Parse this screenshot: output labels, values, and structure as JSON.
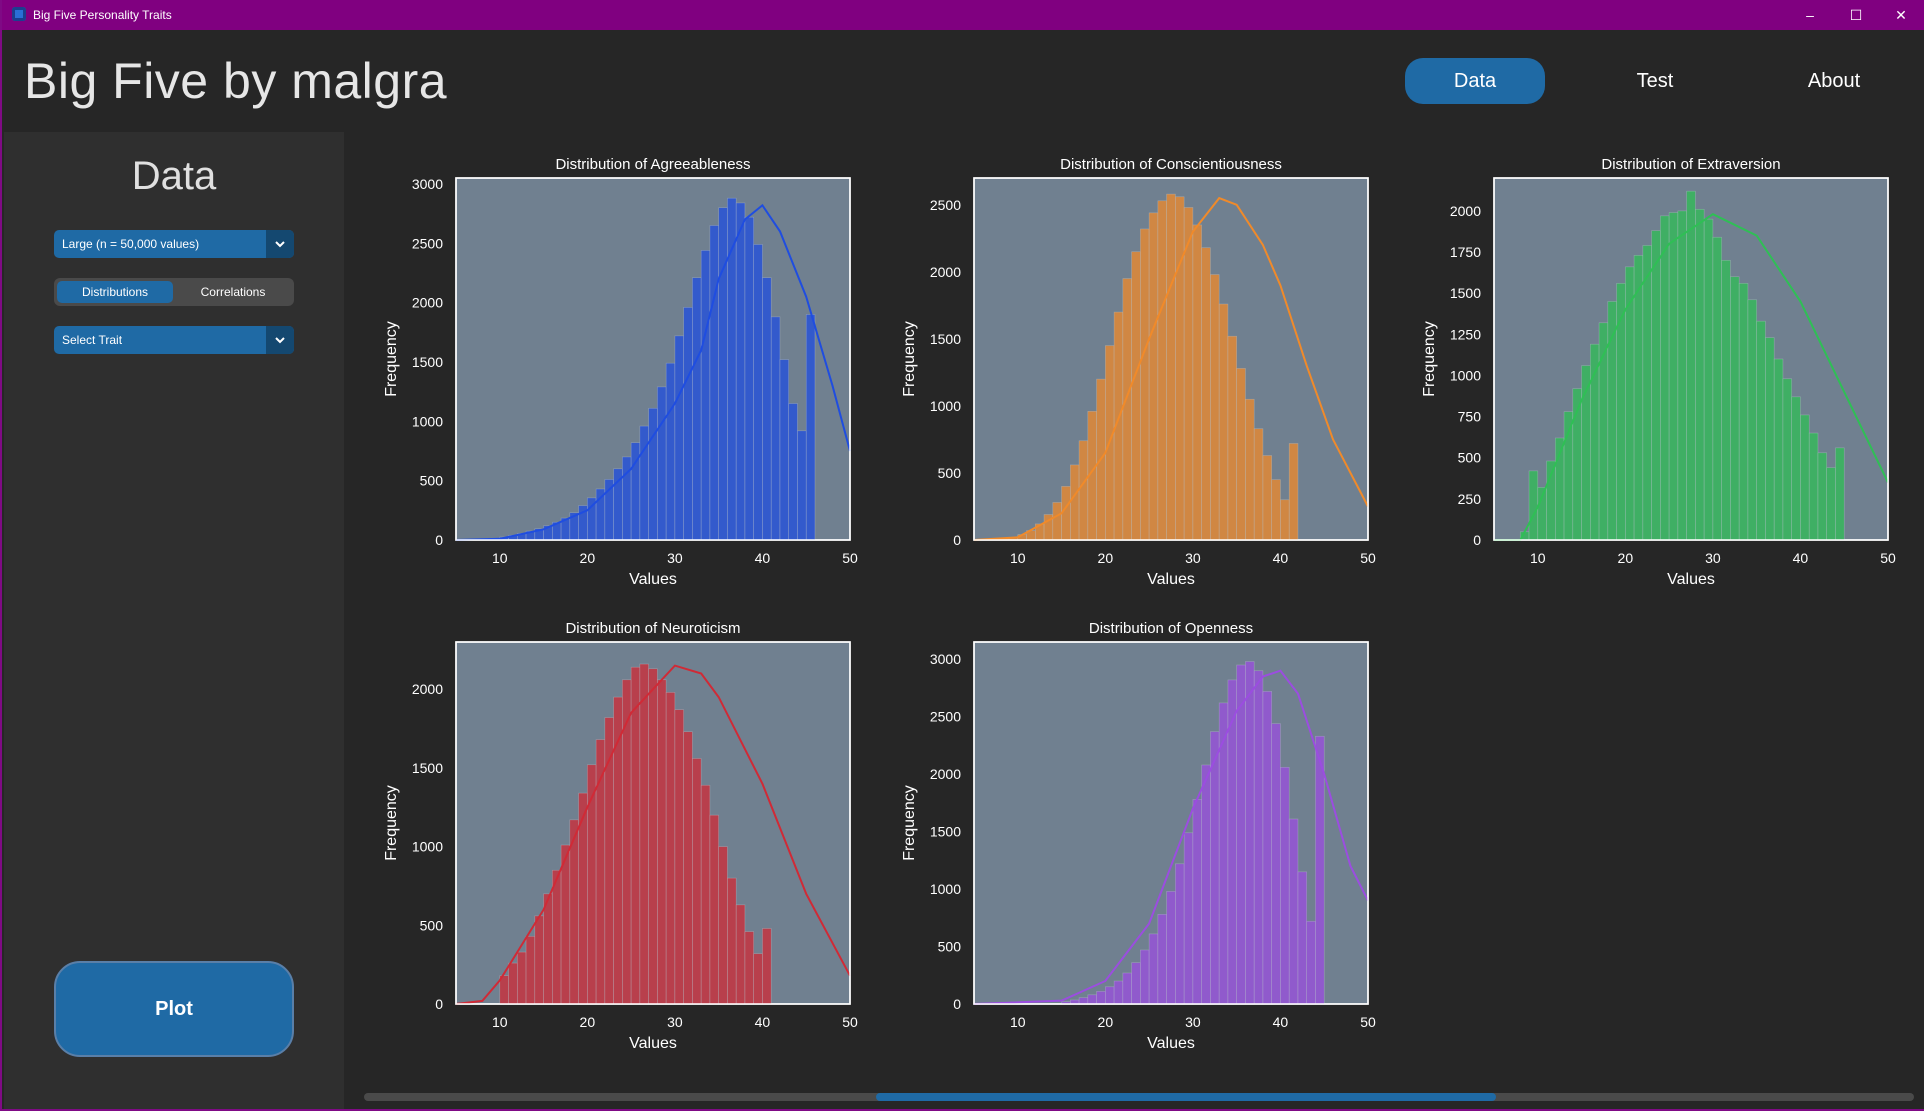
{
  "window": {
    "title": "Big Five Personality Traits",
    "controls": {
      "minimize": "–",
      "maximize": "☐",
      "close": "✕"
    }
  },
  "header": {
    "app_title": "Big Five by malgra",
    "nav": [
      {
        "label": "Data",
        "active": true
      },
      {
        "label": "Test",
        "active": false
      },
      {
        "label": "About",
        "active": false
      }
    ]
  },
  "sidebar": {
    "heading": "Data",
    "dataset_select": {
      "value": "Large (n = 50,000 values)"
    },
    "view_toggle": {
      "options": [
        "Distributions",
        "Correlations"
      ],
      "selected": "Distributions"
    },
    "trait_select": {
      "value": "Select Trait"
    },
    "plot_button": "Plot"
  },
  "colors": {
    "accent": "#1f6aa5",
    "titlebar": "#800080",
    "plot_bg": "#708090"
  },
  "scrollbar": {
    "position": 0.33,
    "visible_fraction": 0.4
  },
  "chart_data": [
    {
      "type": "bar",
      "title": "Distribution of Agreeableness",
      "xlabel": "Values",
      "ylabel": "Frequency",
      "color": "#1f4de0",
      "xlim": [
        5,
        50
      ],
      "ylim": [
        0,
        3050
      ],
      "xticks": [
        10,
        20,
        30,
        40,
        50
      ],
      "yticks": [
        0,
        500,
        1000,
        1500,
        2000,
        2500,
        3000
      ],
      "bin_start": 5,
      "bin_width": 1,
      "values": [
        0,
        0,
        5,
        10,
        15,
        25,
        40,
        55,
        75,
        95,
        120,
        150,
        185,
        230,
        290,
        355,
        430,
        510,
        600,
        700,
        820,
        960,
        1110,
        1290,
        1490,
        1720,
        1960,
        2210,
        2440,
        2650,
        2800,
        2880,
        2840,
        2720,
        2490,
        2210,
        1880,
        1520,
        1150,
        920,
        1900
      ],
      "kde": [
        [
          5,
          0
        ],
        [
          10,
          10
        ],
        [
          15,
          90
        ],
        [
          20,
          250
        ],
        [
          25,
          600
        ],
        [
          30,
          1150
        ],
        [
          33,
          1600
        ],
        [
          35,
          2200
        ],
        [
          38,
          2700
        ],
        [
          40,
          2820
        ],
        [
          42,
          2600
        ],
        [
          45,
          2050
        ],
        [
          48,
          1300
        ],
        [
          50,
          750
        ]
      ]
    },
    {
      "type": "bar",
      "title": "Distribution of Conscientiousness",
      "xlabel": "Values",
      "ylabel": "Frequency",
      "color": "#f08a2a",
      "xlim": [
        5,
        50
      ],
      "ylim": [
        0,
        2700
      ],
      "xticks": [
        10,
        20,
        30,
        40,
        50
      ],
      "yticks": [
        0,
        500,
        1000,
        1500,
        2000,
        2500
      ],
      "bin_start": 5,
      "bin_width": 1,
      "values": [
        0,
        0,
        5,
        10,
        20,
        40,
        70,
        120,
        190,
        280,
        400,
        560,
        740,
        960,
        1200,
        1450,
        1700,
        1950,
        2150,
        2320,
        2440,
        2530,
        2580,
        2560,
        2480,
        2350,
        2180,
        1980,
        1760,
        1520,
        1280,
        1050,
        830,
        630,
        450,
        300,
        720
      ],
      "kde": [
        [
          5,
          0
        ],
        [
          10,
          20
        ],
        [
          15,
          200
        ],
        [
          20,
          650
        ],
        [
          25,
          1500
        ],
        [
          30,
          2300
        ],
        [
          33,
          2550
        ],
        [
          35,
          2500
        ],
        [
          38,
          2200
        ],
        [
          40,
          1900
        ],
        [
          43,
          1300
        ],
        [
          46,
          750
        ],
        [
          50,
          250
        ]
      ]
    },
    {
      "type": "bar",
      "title": "Distribution of Extraversion",
      "xlabel": "Values",
      "ylabel": "Frequency",
      "color": "#2fbf55",
      "xlim": [
        5,
        50
      ],
      "ylim": [
        0,
        2200
      ],
      "xticks": [
        10,
        20,
        30,
        40,
        50
      ],
      "yticks": [
        0,
        250,
        500,
        750,
        1000,
        1250,
        1500,
        1750,
        2000
      ],
      "bin_start": 8,
      "bin_width": 1,
      "values": [
        50,
        420,
        320,
        480,
        620,
        780,
        920,
        1060,
        1190,
        1320,
        1450,
        1560,
        1660,
        1730,
        1790,
        1880,
        1970,
        1990,
        2000,
        2120,
        2010,
        1950,
        1840,
        1700,
        1600,
        1560,
        1460,
        1330,
        1230,
        1100,
        980,
        870,
        760,
        650,
        530,
        440,
        560
      ],
      "kde": [
        [
          5,
          0
        ],
        [
          8,
          0
        ],
        [
          10,
          200
        ],
        [
          15,
          850
        ],
        [
          20,
          1400
        ],
        [
          25,
          1800
        ],
        [
          30,
          1980
        ],
        [
          35,
          1850
        ],
        [
          40,
          1450
        ],
        [
          45,
          900
        ],
        [
          50,
          350
        ]
      ]
    },
    {
      "type": "bar",
      "title": "Distribution of Neuroticism",
      "xlabel": "Values",
      "ylabel": "Frequency",
      "color": "#d02a36",
      "xlim": [
        5,
        50
      ],
      "ylim": [
        0,
        2300
      ],
      "xticks": [
        10,
        20,
        30,
        40,
        50
      ],
      "yticks": [
        0,
        500,
        1000,
        1500,
        2000
      ],
      "bin_start": 10,
      "bin_width": 1,
      "values": [
        180,
        260,
        330,
        430,
        560,
        700,
        850,
        1010,
        1170,
        1340,
        1520,
        1680,
        1820,
        1950,
        2060,
        2140,
        2160,
        2130,
        2060,
        1980,
        1870,
        1730,
        1560,
        1390,
        1200,
        1000,
        800,
        630,
        460,
        320,
        480
      ],
      "kde": [
        [
          5,
          0
        ],
        [
          8,
          20
        ],
        [
          10,
          150
        ],
        [
          15,
          600
        ],
        [
          20,
          1250
        ],
        [
          25,
          1850
        ],
        [
          30,
          2150
        ],
        [
          33,
          2100
        ],
        [
          35,
          1950
        ],
        [
          40,
          1400
        ],
        [
          45,
          700
        ],
        [
          50,
          180
        ]
      ]
    },
    {
      "type": "bar",
      "title": "Distribution of Openness",
      "xlabel": "Values",
      "ylabel": "Frequency",
      "color": "#9b4de0",
      "xlim": [
        5,
        50
      ],
      "ylim": [
        0,
        3150
      ],
      "xticks": [
        10,
        20,
        30,
        40,
        50
      ],
      "yticks": [
        0,
        500,
        1000,
        1500,
        2000,
        2500,
        3000
      ],
      "bin_start": 15,
      "bin_width": 1,
      "values": [
        20,
        35,
        55,
        80,
        110,
        150,
        200,
        270,
        360,
        470,
        610,
        780,
        980,
        1220,
        1490,
        1780,
        2080,
        2370,
        2620,
        2820,
        2950,
        2980,
        2900,
        2720,
        2440,
        2060,
        1610,
        1150,
        720,
        2330
      ],
      "kde": [
        [
          5,
          0
        ],
        [
          15,
          30
        ],
        [
          20,
          200
        ],
        [
          25,
          700
        ],
        [
          30,
          1700
        ],
        [
          35,
          2550
        ],
        [
          38,
          2850
        ],
        [
          40,
          2900
        ],
        [
          42,
          2700
        ],
        [
          45,
          2000
        ],
        [
          48,
          1200
        ],
        [
          50,
          900
        ]
      ]
    }
  ]
}
